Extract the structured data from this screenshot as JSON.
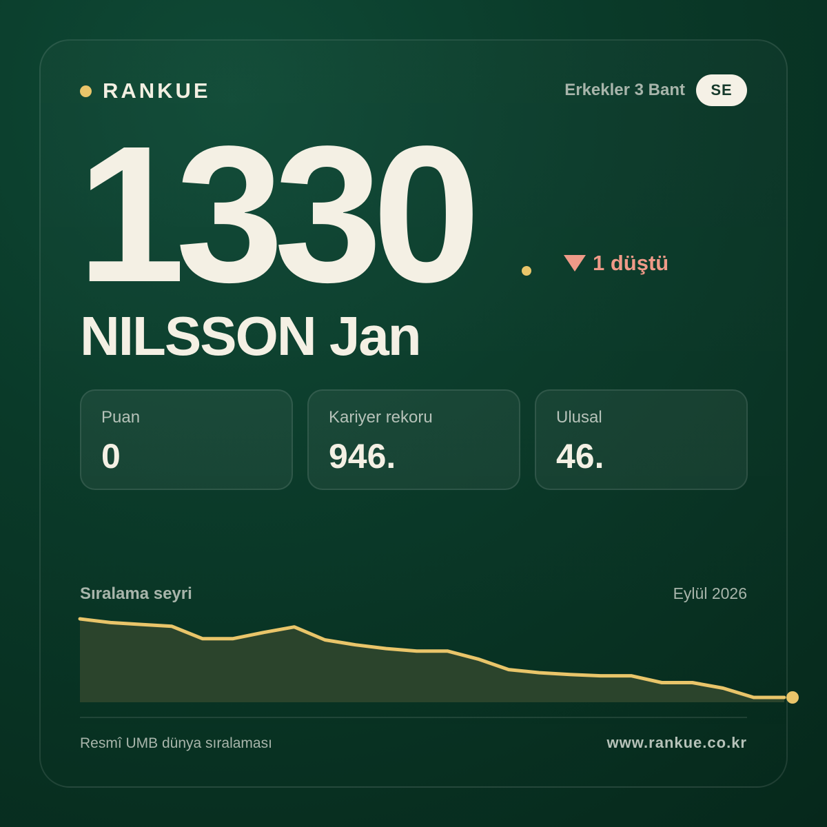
{
  "brand": {
    "name": "RANKUE"
  },
  "header": {
    "division": "Erkekler 3 Bant",
    "country": "SE"
  },
  "ranking": {
    "position": "1330",
    "change_text": "1 düştü",
    "change_direction": "down"
  },
  "player": {
    "name": "NILSSON Jan"
  },
  "stats": [
    {
      "label": "Puan",
      "value": "0"
    },
    {
      "label": "Kariyer rekoru",
      "value": "946."
    },
    {
      "label": "Ulusal",
      "value": "46."
    }
  ],
  "trend": {
    "title": "Sıralama seyri",
    "date": "Eylül 2026"
  },
  "chart_data": {
    "type": "area",
    "title": "Sıralama seyri",
    "xlabel": "",
    "ylabel": "",
    "grid": false,
    "legend": "none",
    "values": [
      0.0,
      0.06,
      0.09,
      0.12,
      0.32,
      0.32,
      0.22,
      0.13,
      0.34,
      0.42,
      0.48,
      0.52,
      0.52,
      0.65,
      0.82,
      0.87,
      0.9,
      0.92,
      0.92,
      1.03,
      1.03,
      1.12,
      1.27,
      1.27
    ],
    "ylim": [
      0,
      1.3
    ],
    "line_color": "#e9c56a",
    "fill_color": "#2b442c"
  },
  "footer": {
    "source": "Resmî UMB dünya sıralaması",
    "url": "www.rankue.co.kr"
  },
  "colors": {
    "accent": "#e9c56a",
    "down": "#ef9a88",
    "text": "#f4f0e4",
    "muted": "#a8b5ab"
  }
}
